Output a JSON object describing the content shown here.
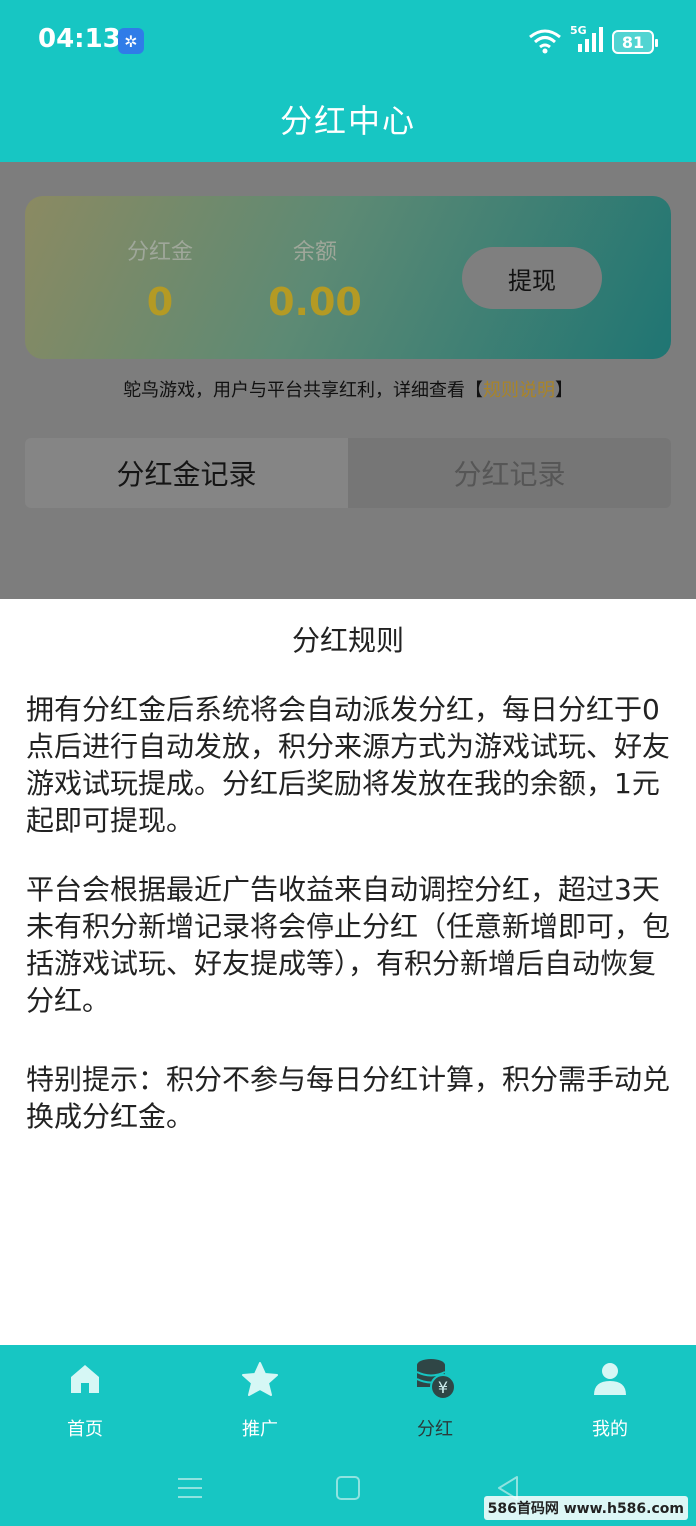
{
  "status_bar": {
    "time": "04:13",
    "network": "5G",
    "battery": "81",
    "icons": [
      "pinwheel-app-icon",
      "wifi-icon",
      "signal-icon",
      "battery-icon"
    ]
  },
  "header": {
    "title": "分红中心"
  },
  "balance_card": {
    "dividend_gold_label": "分红金",
    "dividend_gold_value": "0",
    "balance_label": "余额",
    "balance_value": "0.00",
    "withdraw_label": "提现"
  },
  "rule_note": {
    "text": "鸵鸟游戏，用户与平台共享红利，详细查看【",
    "link": "规则说明",
    "suffix": "】"
  },
  "tabs": [
    {
      "label": "分红金记录",
      "active": true
    },
    {
      "label": "分红记录",
      "active": false
    }
  ],
  "rules_sheet": {
    "title": "分红规则",
    "paragraphs": [
      "拥有分红金后系统将会自动派发分红，每日分红于0点后进行自动发放，积分来源方式为游戏试玩、好友游戏试玩提成。分红后奖励将发放在我的余额，1元起即可提现。",
      "平台会根据最近广告收益来自动调控分红，超过3天未有积分新增记录将会停止分红（任意新增即可，包括游戏试玩、好友提成等），有积分新增后自动恢复分红。",
      "特别提示：积分不参与每日分红计算，积分需手动兑换成分红金。"
    ]
  },
  "bottom_nav": [
    {
      "label": "首页",
      "icon": "home-icon",
      "active": false
    },
    {
      "label": "推广",
      "icon": "star-icon",
      "active": false
    },
    {
      "label": "分红",
      "icon": "coins-icon",
      "active": true
    },
    {
      "label": "我的",
      "icon": "user-icon",
      "active": false
    }
  ],
  "watermark": "586首码网 www.h586.com",
  "colors": {
    "primary": "#17c6c3",
    "gold": "#b49a24",
    "link": "#a8842a"
  }
}
